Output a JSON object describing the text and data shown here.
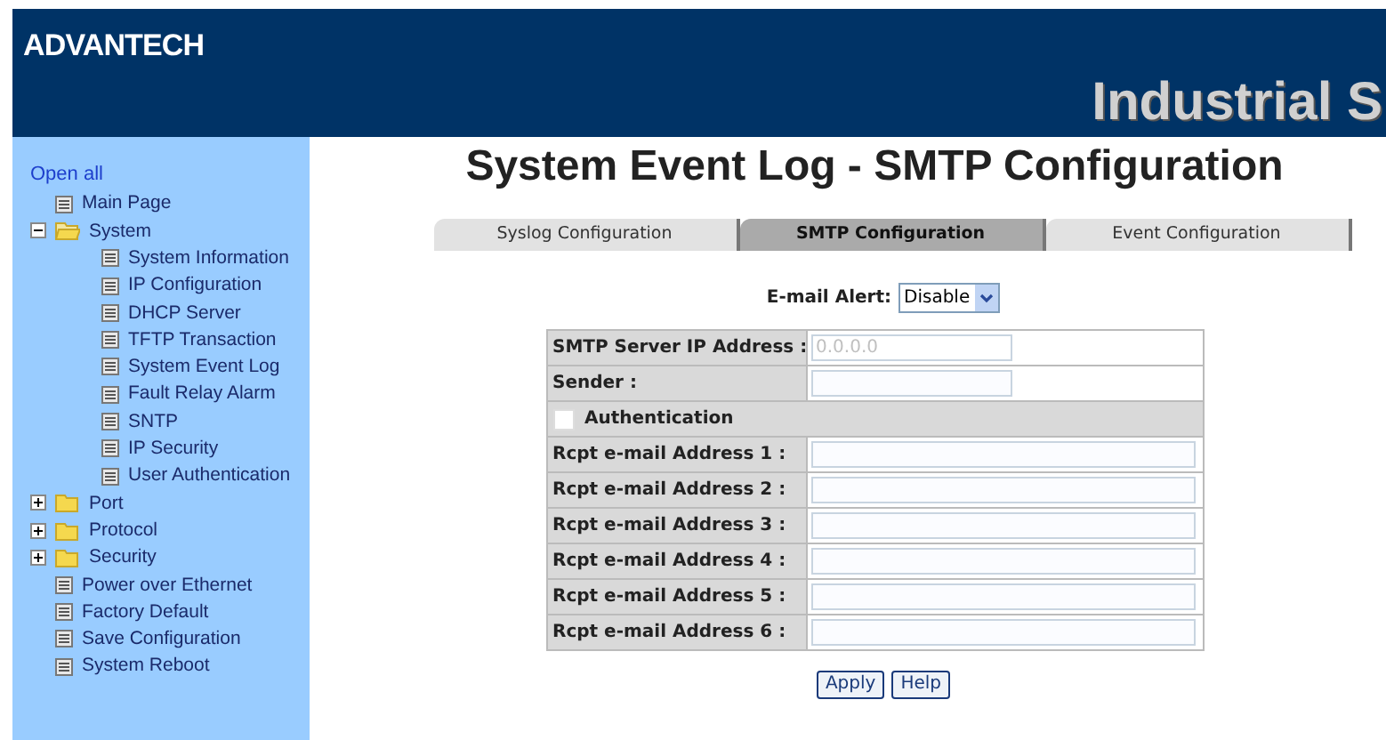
{
  "header": {
    "logo": "ADVANTECH",
    "banner": "Industrial S"
  },
  "sidebar": {
    "open_all": "Open all",
    "items": [
      {
        "kind": "page",
        "label": "Main Page"
      },
      {
        "kind": "folder",
        "label": "System",
        "expanded": true,
        "children": [
          {
            "kind": "page",
            "label": "System Information"
          },
          {
            "kind": "page",
            "label": "IP Configuration"
          },
          {
            "kind": "page",
            "label": "DHCP Server"
          },
          {
            "kind": "page",
            "label": "TFTP Transaction"
          },
          {
            "kind": "page",
            "label": "System Event Log"
          },
          {
            "kind": "page",
            "label": "Fault Relay Alarm"
          },
          {
            "kind": "page",
            "label": "SNTP"
          },
          {
            "kind": "page",
            "label": "IP Security"
          },
          {
            "kind": "page",
            "label": "User Authentication"
          }
        ]
      },
      {
        "kind": "folder",
        "label": "Port",
        "expanded": false
      },
      {
        "kind": "folder",
        "label": "Protocol",
        "expanded": false
      },
      {
        "kind": "folder",
        "label": "Security",
        "expanded": false
      },
      {
        "kind": "page",
        "label": "Power over Ethernet"
      },
      {
        "kind": "page",
        "label": "Factory Default"
      },
      {
        "kind": "page",
        "label": "Save Configuration"
      },
      {
        "kind": "page",
        "label": "System Reboot"
      }
    ]
  },
  "page_title": "System Event Log - SMTP Configuration",
  "tabs": [
    {
      "label": "Syslog Configuration",
      "selected": false
    },
    {
      "label": "SMTP Configuration",
      "selected": true
    },
    {
      "label": "Event Configuration",
      "selected": false
    }
  ],
  "email_alert": {
    "label": "E-mail Alert:",
    "value": "Disable"
  },
  "form_rows": [
    {
      "kind": "short",
      "label": "SMTP Server IP Address :",
      "value": "0.0.0.0",
      "disabled": true
    },
    {
      "kind": "short",
      "label": "Sender :"
    },
    {
      "kind": "checkbox",
      "label": "Authentication",
      "checked": false
    },
    {
      "kind": "long",
      "label": "Rcpt e-mail Address 1 :"
    },
    {
      "kind": "long",
      "label": "Rcpt e-mail Address 2 :"
    },
    {
      "kind": "long",
      "label": "Rcpt e-mail Address 3 :"
    },
    {
      "kind": "long",
      "label": "Rcpt e-mail Address 4 :"
    },
    {
      "kind": "long",
      "label": "Rcpt e-mail Address 5 :"
    },
    {
      "kind": "long",
      "label": "Rcpt e-mail Address 6 :"
    }
  ],
  "buttons": [
    "Apply",
    "Help"
  ]
}
